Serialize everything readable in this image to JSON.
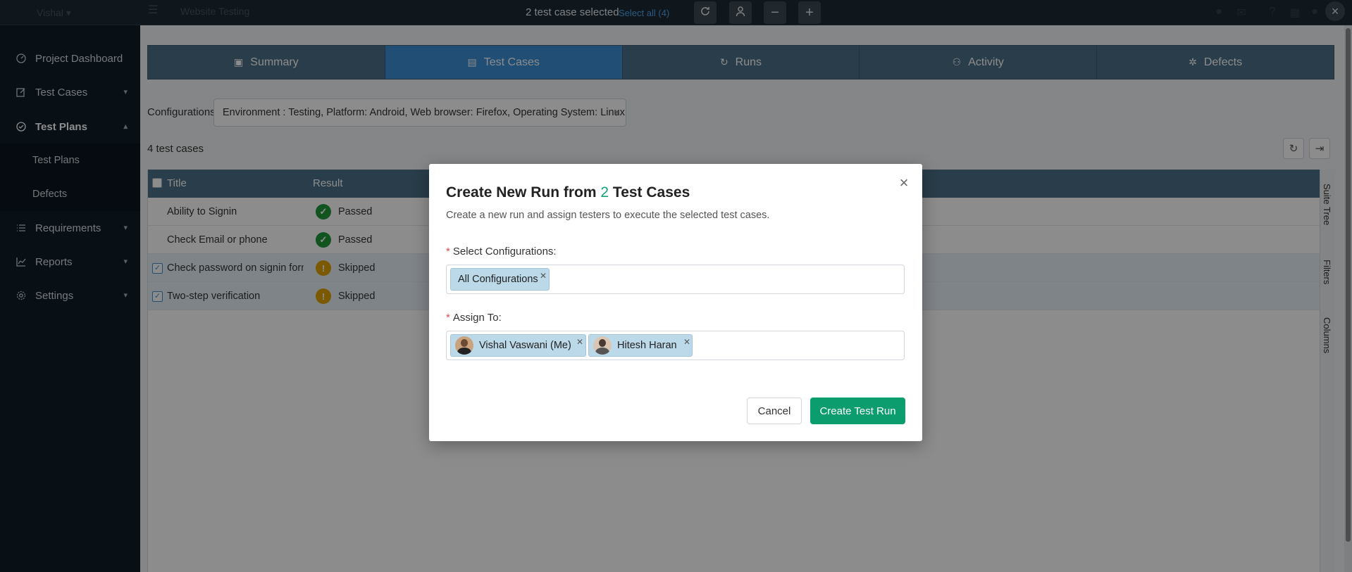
{
  "topbar": {
    "org_name": "Vishal ▾",
    "project_name": "Website Testing",
    "selection_text": "2 test case selected",
    "select_all_label": "Select all (4)",
    "refresh_icon": "refresh-icon",
    "assign_icon": "user-icon",
    "minus_icon": "minus-icon",
    "plus_icon": "plus-icon",
    "close_icon": "close-icon"
  },
  "sidebar": {
    "items": [
      {
        "label": "Project Dashboard",
        "icon": "dashboard-icon"
      },
      {
        "label": "Test Cases",
        "icon": "edit-icon"
      },
      {
        "label": "Test Plans",
        "icon": "check-circle-icon"
      },
      {
        "label": "Requirements",
        "icon": "list-icon"
      },
      {
        "label": "Reports",
        "icon": "chart-icon"
      },
      {
        "label": "Settings",
        "icon": "gear-icon"
      }
    ],
    "sub_items": [
      "Test Plans",
      "Defects"
    ]
  },
  "tabs": [
    {
      "label": "Summary",
      "icon": "summary-icon"
    },
    {
      "label": "Test Cases",
      "icon": "test-cases-icon"
    },
    {
      "label": "Runs",
      "icon": "runs-icon"
    },
    {
      "label": "Activity",
      "icon": "activity-icon"
    },
    {
      "label": "Defects",
      "icon": "bug-icon"
    }
  ],
  "configurations": {
    "label": "Configurations",
    "value": "Environment : Testing, Platform: Android, Web browser: Firefox, Operating System: Linux"
  },
  "list": {
    "count_label": "4 test cases",
    "columns": [
      "Title",
      "Result"
    ],
    "rows": [
      {
        "title": "Ability to Signin",
        "result": "Passed",
        "selected": false
      },
      {
        "title": "Check Email or phone",
        "result": "Passed",
        "selected": false
      },
      {
        "title": "Check password on signin form",
        "result": "Skipped",
        "selected": true
      },
      {
        "title": "Two-step verification",
        "result": "Skipped",
        "selected": true
      }
    ],
    "side_tabs": [
      "Suite Tree",
      "Filters",
      "Columns"
    ]
  },
  "modal": {
    "title_prefix": "Create New Run from",
    "title_count": "2",
    "title_suffix": "Test Cases",
    "description": "Create a new run and assign testers to execute the selected test cases.",
    "config_label": "Select Configurations:",
    "config_chip": "All Configurations",
    "assign_label": "Assign To:",
    "assignees": [
      "Vishal Vaswani (Me)",
      "Hitesh Haran"
    ],
    "cancel_label": "Cancel",
    "create_label": "Create Test Run"
  },
  "colors": {
    "accent_blue": "#3b8ed6",
    "primary_green": "#0c9d6f",
    "passed": "#1f9a3a",
    "skipped": "#e0a300"
  }
}
